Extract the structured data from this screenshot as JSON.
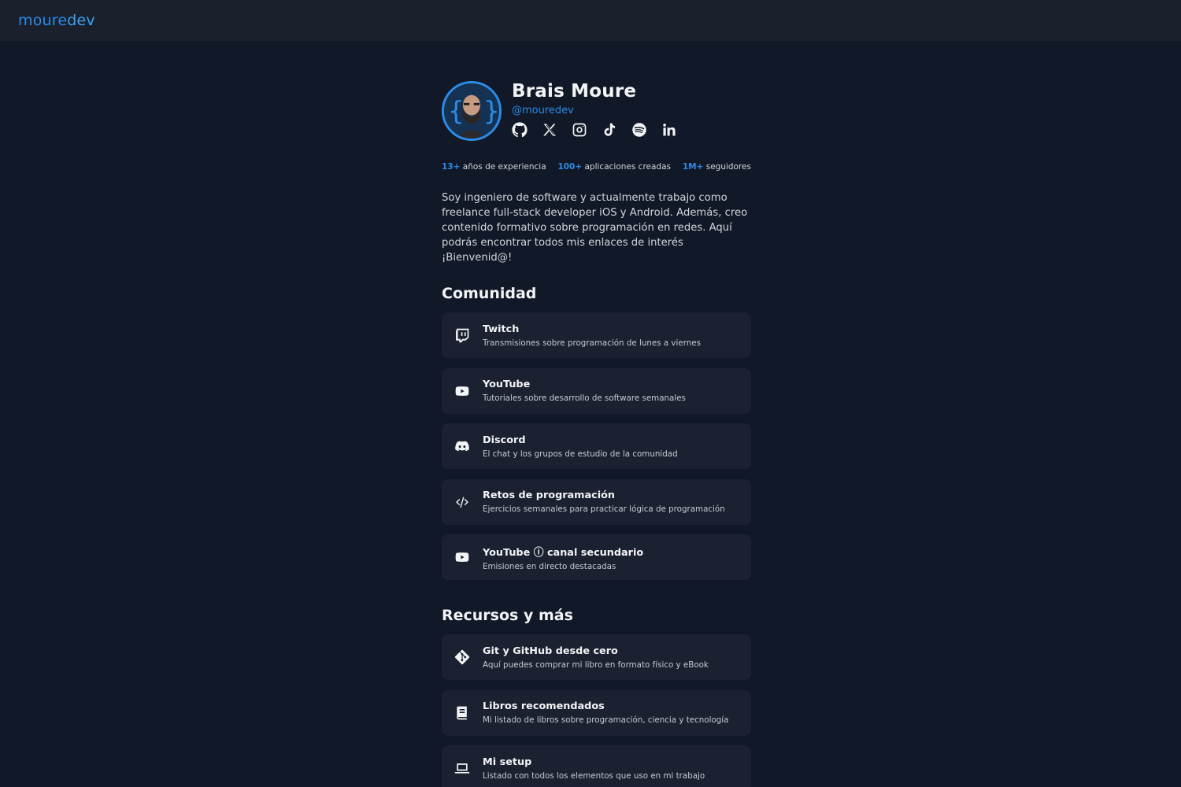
{
  "brand": {
    "logo_part1": "moure",
    "logo_part2": "dev"
  },
  "profile": {
    "name": "Brais Moure",
    "handle": "@mouredev",
    "socials": [
      {
        "icon": "github-icon"
      },
      {
        "icon": "x-icon"
      },
      {
        "icon": "instagram-icon"
      },
      {
        "icon": "tiktok-icon"
      },
      {
        "icon": "spotify-icon"
      },
      {
        "icon": "linkedin-icon"
      }
    ]
  },
  "stats": [
    {
      "number": "13+",
      "label": "años de experiencia"
    },
    {
      "number": "100+",
      "label": "aplicaciones creadas"
    },
    {
      "number": "1M+",
      "label": "seguidores"
    }
  ],
  "bio": "Soy ingeniero de software y actualmente trabajo como freelance full-stack developer iOS y Android. Además, creo contenido formativo sobre programación en redes. Aquí podrás encontrar todos mis enlaces de interés ¡Bienvenid@!",
  "sections": [
    {
      "title": "Comunidad",
      "links": [
        {
          "icon": "twitch-icon",
          "title": "Twitch",
          "subtitle": "Transmisiones sobre programación de lunes a viernes"
        },
        {
          "icon": "youtube-icon",
          "title": "YouTube",
          "subtitle": "Tutoriales sobre desarrollo de software semanales"
        },
        {
          "icon": "discord-icon",
          "title": "Discord",
          "subtitle": "El chat y los grupos de estudio de la comunidad"
        },
        {
          "icon": "code-icon",
          "title": "Retos de programación",
          "subtitle": "Ejercicios semanales para practicar lógica de programación"
        },
        {
          "icon": "youtube-icon",
          "title": "YouTube ⓘ canal secundario",
          "subtitle": "Emisiones en directo destacadas"
        }
      ]
    },
    {
      "title": "Recursos y más",
      "links": [
        {
          "icon": "git-icon",
          "title": "Git y GitHub desde cero",
          "subtitle": "Aquí puedes comprar mi libro en formato físico y eBook"
        },
        {
          "icon": "book-icon",
          "title": "Libros recomendados",
          "subtitle": "Mi listado de libros sobre programación, ciencia y tecnología"
        },
        {
          "icon": "laptop-icon",
          "title": "Mi setup",
          "subtitle": "Listado con todos los elementos que uso en mi trabajo"
        }
      ]
    }
  ]
}
